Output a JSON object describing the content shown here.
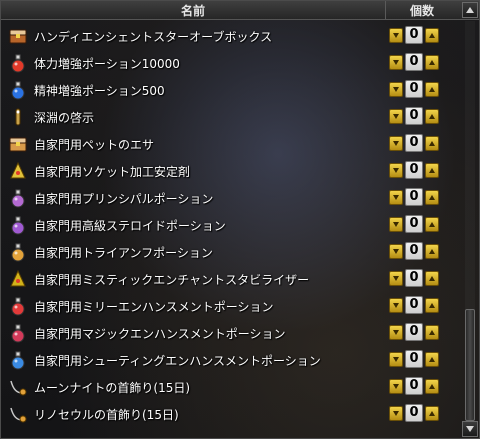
{
  "header": {
    "name_label": "名前",
    "qty_label": "個数"
  },
  "items": [
    {
      "name": "ハンディエンシェントスターオーブボックス",
      "qty": "0",
      "icon": "treasure-box-icon",
      "color": "#b8652a"
    },
    {
      "name": "体力増強ポーション10000",
      "qty": "0",
      "icon": "red-potion-icon",
      "color": "#e23a2a"
    },
    {
      "name": "精神増強ポーション500",
      "qty": "0",
      "icon": "blue-potion-icon",
      "color": "#2a72e2"
    },
    {
      "name": "深淵の啓示",
      "qty": "0",
      "icon": "abyss-scroll-icon",
      "color": "#c8a24a"
    },
    {
      "name": "自家門用ペットのエサ",
      "qty": "0",
      "icon": "pet-food-box-icon",
      "color": "#d89a4a"
    },
    {
      "name": "自家門用ソケット加工安定剤",
      "qty": "0",
      "icon": "socket-stabilizer-icon",
      "color": "#e2c23a"
    },
    {
      "name": "自家門用プリンシパルポーション",
      "qty": "0",
      "icon": "principal-potion-icon",
      "color": "#b46ad2"
    },
    {
      "name": "自家門用高級ステロイドポーション",
      "qty": "0",
      "icon": "steroid-potion-icon",
      "color": "#a05ad2"
    },
    {
      "name": "自家門用トライアンフポーション",
      "qty": "0",
      "icon": "triumph-potion-icon",
      "color": "#e2a23a"
    },
    {
      "name": "自家門用ミスティックエンチャントスタビライザー",
      "qty": "0",
      "icon": "mystic-stabilizer-icon",
      "color": "#d2b21a"
    },
    {
      "name": "自家門用ミリーエンハンスメントポーション",
      "qty": "0",
      "icon": "melee-potion-icon",
      "color": "#e23a3a"
    },
    {
      "name": "自家門用マジックエンハンスメントポーション",
      "qty": "0",
      "icon": "magic-potion-icon",
      "color": "#d23a5a"
    },
    {
      "name": "自家門用シューティングエンハンスメントポーション",
      "qty": "0",
      "icon": "shooting-potion-icon",
      "color": "#3a8ae2"
    },
    {
      "name": "ムーンナイトの首飾り(15日)",
      "qty": "0",
      "icon": "necklace-icon",
      "color": "#e2a23a"
    },
    {
      "name": "リノセウルの首飾り(15日)",
      "qty": "0",
      "icon": "necklace-icon",
      "color": "#e2a23a"
    }
  ]
}
